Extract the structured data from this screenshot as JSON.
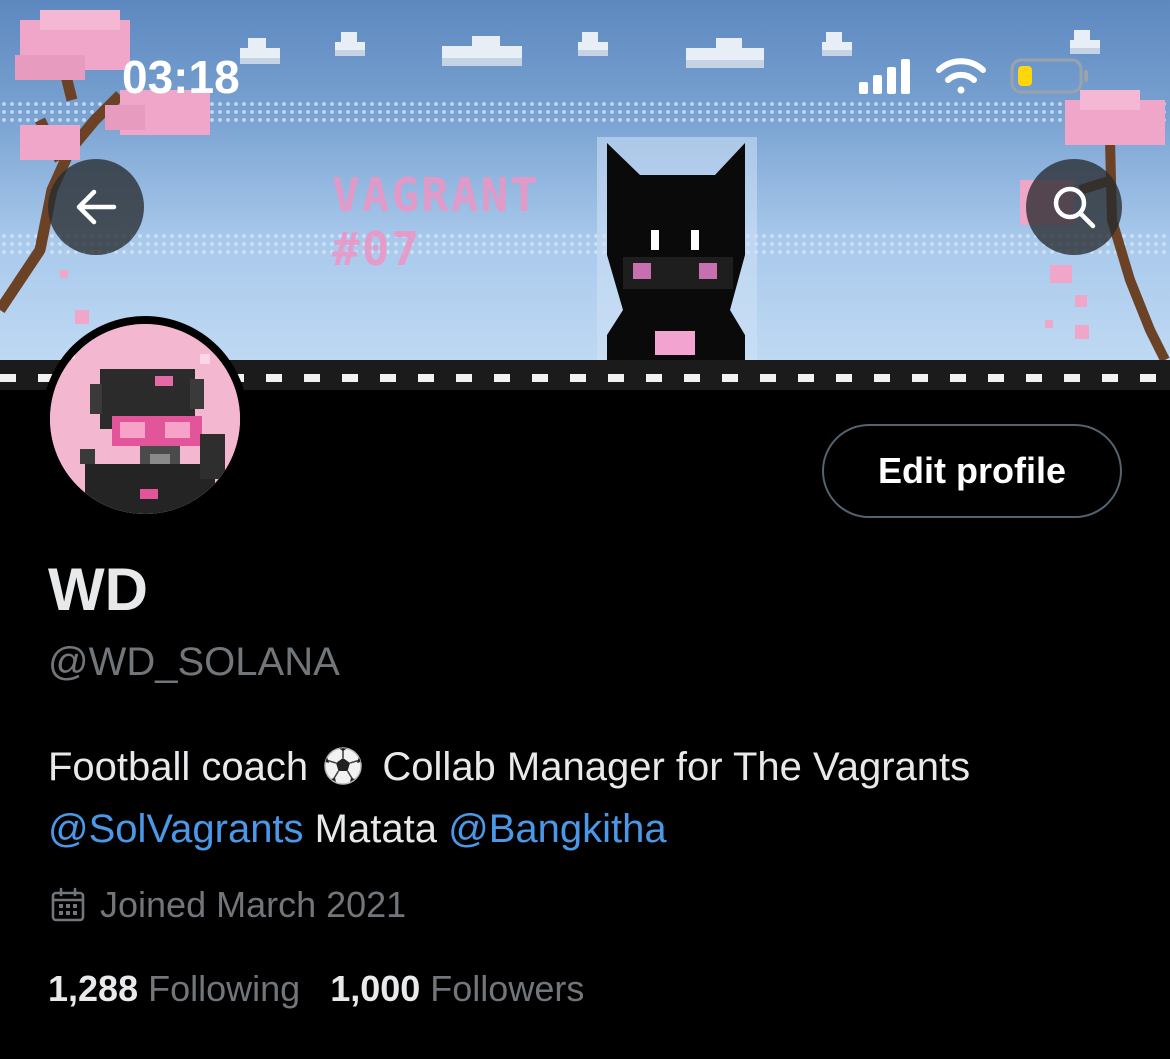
{
  "status_bar": {
    "time": "03:18",
    "signal_icon": "cellular-signal-icon",
    "wifi_icon": "wifi-icon",
    "battery_icon": "battery-low-icon",
    "battery_color": "#ffd60a"
  },
  "header": {
    "banner_text_line1": "VAGRANT",
    "banner_text_line2": "#07",
    "back_icon": "arrow-left-icon",
    "search_icon": "search-icon"
  },
  "profile": {
    "edit_button_label": "Edit profile",
    "display_name": "WD",
    "handle": "@WD_SOLANA",
    "bio": {
      "part1": "Football coach",
      "emoji_icon": "soccer-ball-icon",
      "part2": "Collab Manager for The Vagrants",
      "mention1": "@SolVagrants",
      "part3": "Matata",
      "mention2": "@Bangkitha"
    },
    "joined_icon": "calendar-icon",
    "joined_text": "Joined March 2021",
    "following_count": "1,288",
    "following_label": "Following",
    "followers_count": "1,000",
    "followers_label": "Followers"
  },
  "colors": {
    "background": "#000000",
    "text_primary": "#e7e9ea",
    "text_secondary": "#71767b",
    "link": "#4a99e9",
    "button_border": "#536471",
    "banner_sky": "#7aa3d2",
    "banner_pink": "#ef94c4"
  }
}
